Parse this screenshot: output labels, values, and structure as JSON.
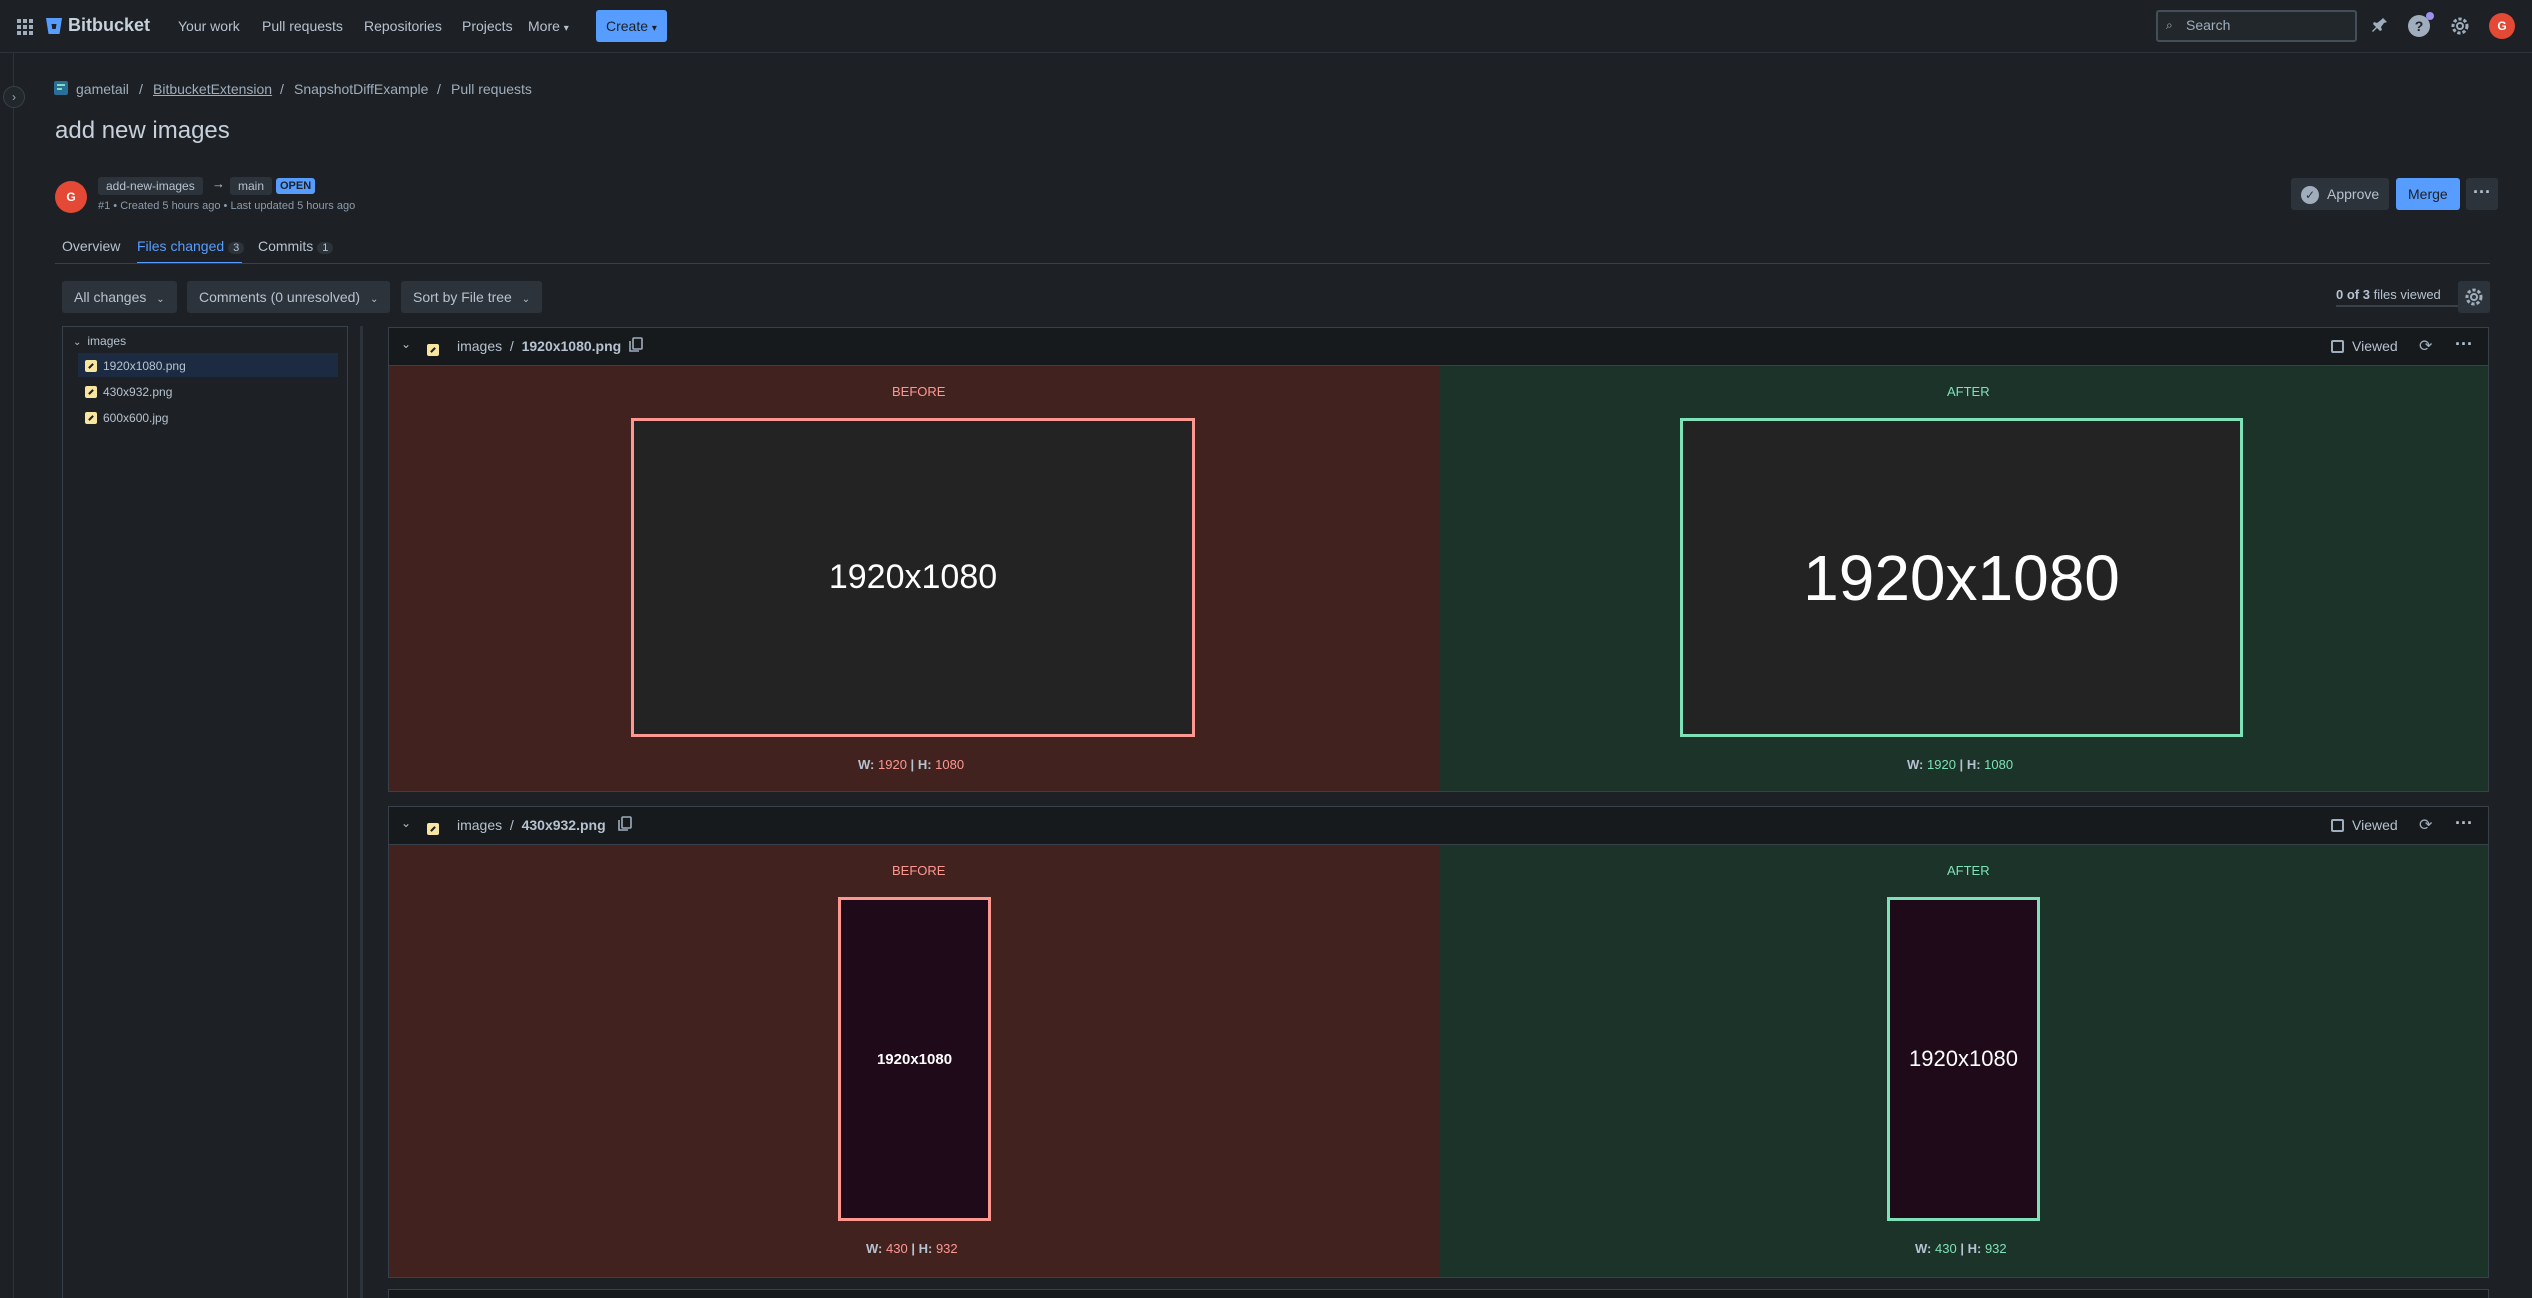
{
  "nav": {
    "brand": "Bitbucket",
    "links": [
      "Your work",
      "Pull requests",
      "Repositories",
      "Projects",
      "More"
    ],
    "create_label": "Create",
    "search_placeholder": "Search",
    "avatar_initial": "G"
  },
  "breadcrumb": [
    "gametail",
    "BitbucketExtension",
    "SnapshotDiffExample",
    "Pull requests"
  ],
  "pr": {
    "title": "add new images",
    "source_branch": "add-new-images",
    "target_branch": "main",
    "status": "OPEN",
    "meta": "#1 • Created 5 hours ago • Last updated 5 hours ago",
    "author_initial": "G",
    "approve_label": "Approve",
    "merge_label": "Merge"
  },
  "tabs": [
    {
      "label": "Overview"
    },
    {
      "label": "Files changed",
      "count": "3"
    },
    {
      "label": "Commits",
      "count": "1"
    }
  ],
  "filters": {
    "changes": "All changes",
    "comments": "Comments (0 unresolved)",
    "sort": "Sort by File tree",
    "files_viewed_bold": "0 of 3",
    "files_viewed_rest": "files viewed"
  },
  "tree": {
    "folder": "images",
    "files": [
      "1920x1080.png",
      "430x932.png",
      "600x600.jpg"
    ]
  },
  "diffs": [
    {
      "folder": "images",
      "file": "1920x1080.png",
      "viewed_label": "Viewed",
      "before_label": "BEFORE",
      "after_label": "AFTER",
      "before_text": "1920x1080",
      "after_text": "1920x1080",
      "before_w": "1920",
      "before_h": "1080",
      "after_w": "1920",
      "after_h": "1080"
    },
    {
      "folder": "images",
      "file": "430x932.png",
      "viewed_label": "Viewed",
      "before_label": "BEFORE",
      "after_label": "AFTER",
      "before_text": "1920x1080",
      "after_text": "1920x1080",
      "before_w": "430",
      "before_h": "932",
      "after_w": "430",
      "after_h": "932"
    }
  ],
  "dim_labels": {
    "w": "W:",
    "h": "H:",
    "sep": "|"
  },
  "colors": {
    "accent": "#579dff",
    "before_bg": "#42221f",
    "after_bg": "#1c3329",
    "before_border": "#fd9891",
    "after_border": "#7ee2b8"
  }
}
